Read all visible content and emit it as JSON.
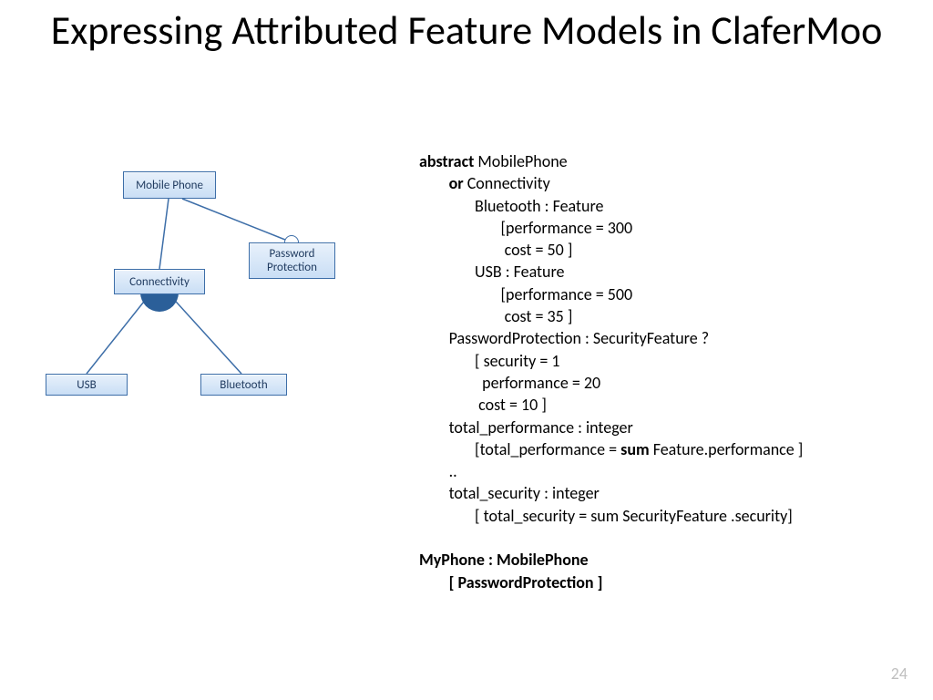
{
  "title": "Expressing Attributed Feature Models in ClaferMoo",
  "page_number": "24",
  "diagram": {
    "nodes": {
      "root": {
        "label": "Mobile Phone"
      },
      "connectivity": {
        "label": "Connectivity"
      },
      "password": {
        "label": "Password Protection"
      },
      "usb": {
        "label": "USB"
      },
      "bluetooth": {
        "label": "Bluetooth"
      }
    }
  },
  "code": {
    "l01a": "abstract",
    "l01b": " MobilePhone",
    "l02a": "or",
    "l02b": " Connectivity",
    "l03": "Bluetooth : Feature",
    "l04": "[performance = 300",
    "l05": " cost = 50 ]",
    "l06": "USB : Feature",
    "l07": "[performance = 500",
    "l08": " cost = 35 ]",
    "l09": "PasswordProtection : SecurityFeature ?",
    "l10": "[ security = 1",
    "l11": "  performance = 20",
    "l12": " cost = 10 ]",
    "l13": "total_performance : integer",
    "l14a": "[total_performance = ",
    "l14b": "sum",
    "l14c": " Feature.performance ]",
    "l15": "..",
    "l16": "total_security : integer",
    "l17": "[ total_security = sum SecurityFeature .security]",
    "l18": "MyPhone : MobilePhone",
    "l19": "[ PasswordProtection ]"
  }
}
